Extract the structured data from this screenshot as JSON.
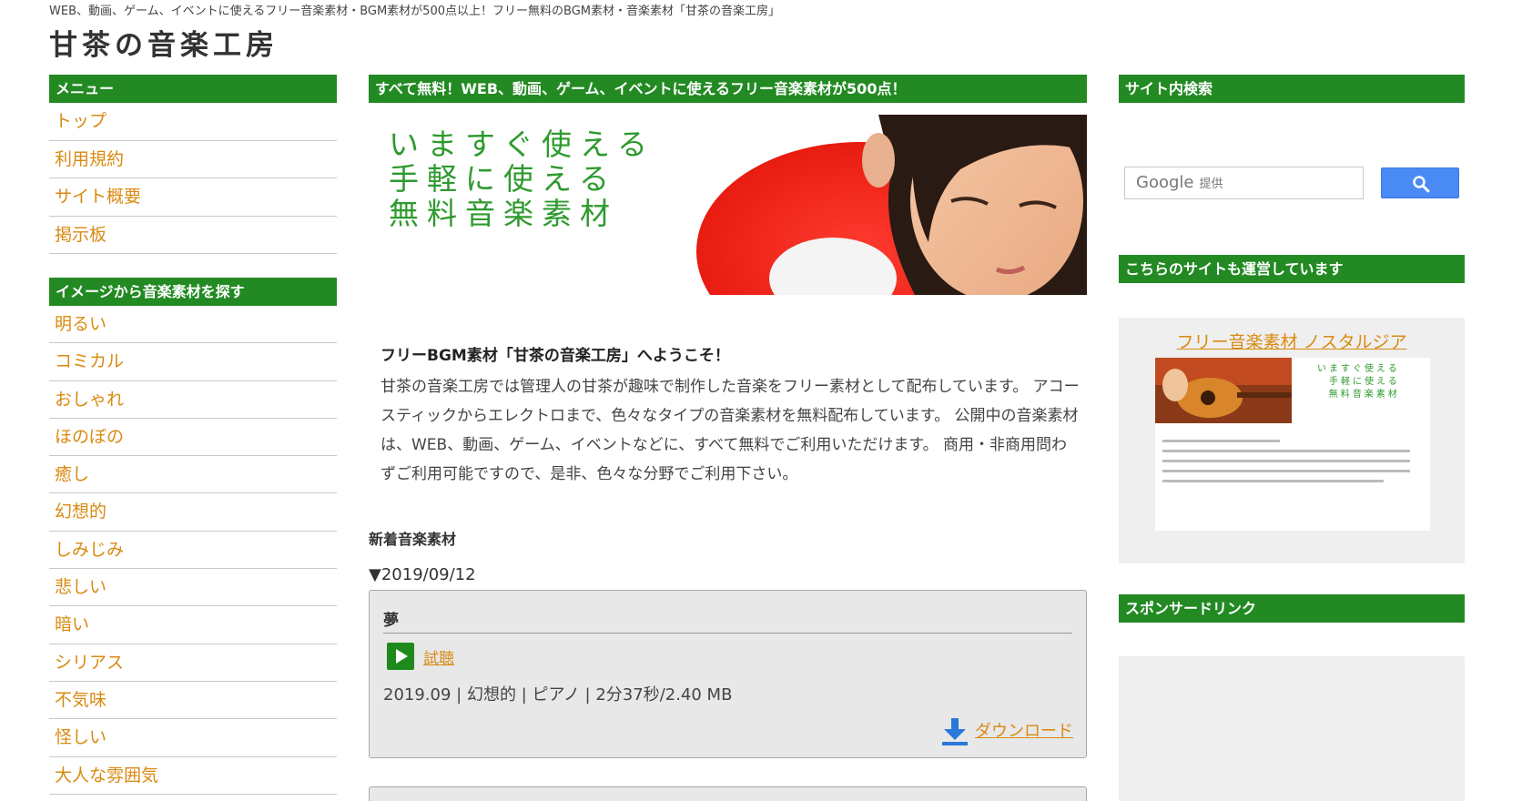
{
  "header": {
    "tagline": "WEB、動画、ゲーム、イベントに使えるフリー音楽素材・BGM素材が500点以上！フリー無料のBGM素材・音楽素材「甘茶の音楽工房」",
    "site_title": "甘茶の音楽工房"
  },
  "left": {
    "menu_heading": "メニュー",
    "menu_items": [
      "トップ",
      "利用規約",
      "サイト概要",
      "掲示板"
    ],
    "image_heading": "イメージから音楽素材を探す",
    "image_items": [
      "明るい",
      "コミカル",
      "おしゃれ",
      "ほのぼの",
      "癒し",
      "幻想的",
      "しみじみ",
      "悲しい",
      "暗い",
      "シリアス",
      "不気味",
      "怪しい",
      "大人な雰囲気"
    ]
  },
  "center": {
    "banner_heading": "すべて無料！WEB、動画、ゲーム、イベントに使えるフリー音楽素材が500点！",
    "hero_lines": [
      "いますぐ使える",
      "手軽に使える",
      "無料音楽素材"
    ],
    "welcome_title": "フリーBGM素材「甘茶の音楽工房」へようこそ！",
    "welcome_body": "甘茶の音楽工房では管理人の甘茶が趣味で制作した音楽をフリー素材として配布しています。 アコースティックからエレクトロまで、色々なタイプの音楽素材を無料配布しています。 公開中の音楽素材は、WEB、動画、ゲーム、イベントなどに、すべて無料でご利用いただけます。 商用・非商用問わずご利用可能ですので、是非、色々な分野でご利用下さい。",
    "new_heading": "新着音楽素材",
    "date": "▼2019/09/12",
    "track": {
      "title": "夢",
      "trial_label": "試聴",
      "meta": "2019.09 | 幻想的 | ピアノ | 2分37秒/2.40 MB",
      "download_label": "ダウンロード"
    }
  },
  "right": {
    "search_heading": "サイト内検索",
    "search_brand": "Google",
    "search_provided": "提供",
    "other_sites_heading": "こちらのサイトも運営しています",
    "other_site_link": "フリー音楽素材 ノスタルジア",
    "promo_lines": [
      "いますぐ使える",
      "手軽に使える",
      "無料音楽素材"
    ],
    "sponsor_heading": "スポンサードリンク"
  },
  "colors": {
    "green": "#238a23",
    "link_orange": "#d98a12",
    "search_blue": "#4a8af4"
  }
}
